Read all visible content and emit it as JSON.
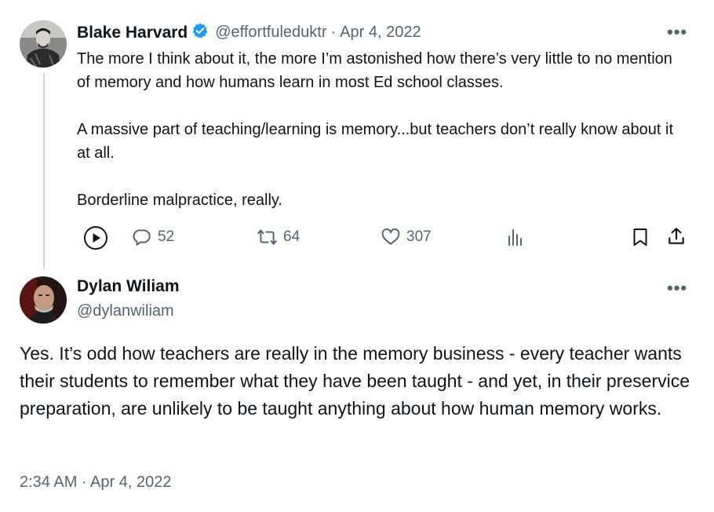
{
  "tweet1": {
    "author_name": "Blake Harvard",
    "handle": "@effortfuleduktr",
    "separator": "·",
    "date": "Apr 4, 2022",
    "more_label": "•••",
    "paragraphs": [
      "The more I think about it, the more I’m astonished how there’s very little to no mention of memory and how humans learn in most Ed school classes.",
      "A massive part of teaching/learning is memory...but teachers don’t really know about it at all.",
      "Borderline malpractice, really."
    ],
    "actions": {
      "replies": "52",
      "reposts": "64",
      "likes": "307"
    }
  },
  "tweet2": {
    "author_name": "Dylan Wiliam",
    "handle": "@dylanwiliam",
    "more_label": "•••",
    "text": "Yes. It’s odd how teachers are really in the memory business - every teacher wants their students to remember what they have been taught - and yet, in their preservice preparation, are unlikely to be taught anything about how human memory works.",
    "timestamp": "2:34 AM · Apr 4, 2022"
  },
  "colors": {
    "text": "#0f1419",
    "muted": "#536471",
    "verified_blue": "#1d9bf0",
    "thread_line": "#cfd9de"
  },
  "icons": [
    "verified-badge-icon",
    "more-icon",
    "play-icon",
    "reply-icon",
    "repost-icon",
    "like-icon",
    "views-icon",
    "bookmark-icon",
    "share-icon"
  ]
}
